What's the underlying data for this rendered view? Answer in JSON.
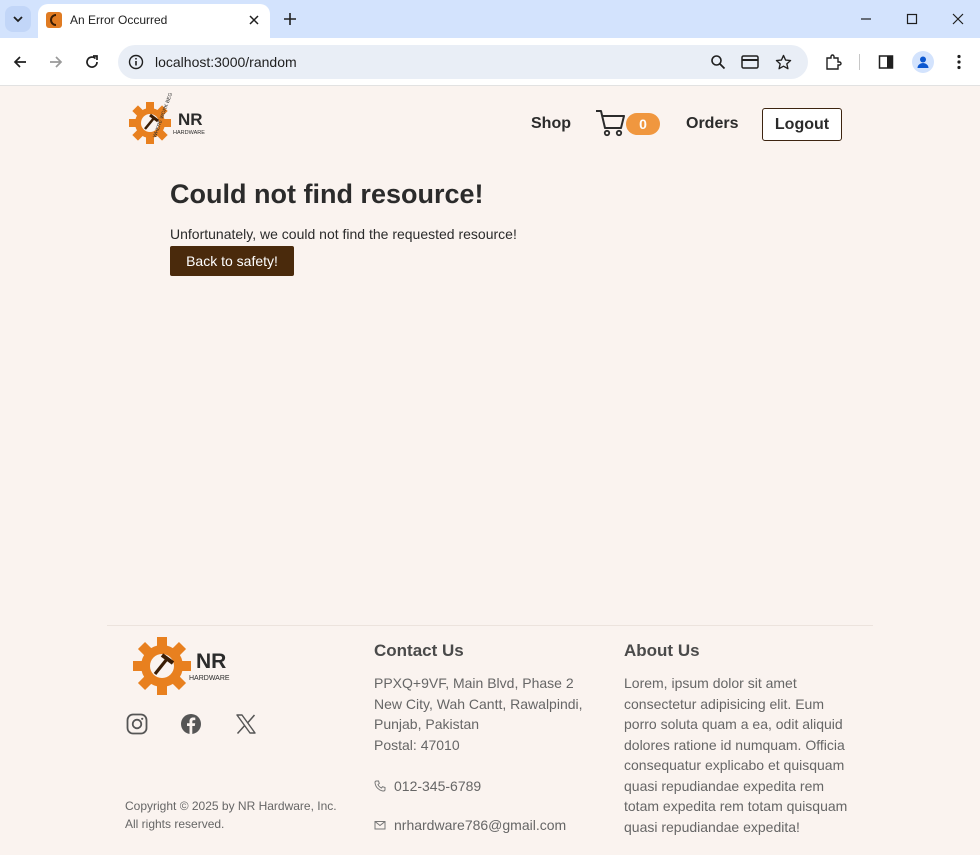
{
  "browser": {
    "tab_title": "An Error Occurred",
    "url": "localhost:3000/random"
  },
  "header": {
    "logo": {
      "brand": "NR",
      "sub": "HARDWARE",
      "tagline": "WHERE WORK BEGINS"
    },
    "nav_shop": "Shop",
    "cart_count": "0",
    "nav_orders": "Orders",
    "logout_label": "Logout"
  },
  "main": {
    "title": "Could not find resource!",
    "message": "Unfortunately, we could not find the requested resource!",
    "back_label": "Back to safety!"
  },
  "footer": {
    "copyright": "Copyright © 2025 by NR Hardware, Inc. All rights reserved.",
    "contact": {
      "title": "Contact Us",
      "address": [
        "PPXQ+9VF, Main Blvd, Phase 2 New City, Wah Cantt, Rawalpindi, Punjab, Pakistan",
        "Postal: 47010"
      ],
      "phone": "012-345-6789",
      "email": "nrhardware786@gmail.com"
    },
    "about": {
      "title": "About Us",
      "text": "Lorem, ipsum dolor sit amet consectetur adipisicing elit. Eum porro soluta quam a ea, odit aliquid dolores ratione id numquam. Officia consequatur explicabo et quisquam quasi repudiandae expedita rem totam expedita rem totam quisquam quasi repudiandae expedita!"
    }
  },
  "colors": {
    "accent": "#f0973f",
    "button_dark": "#4a2a0c",
    "page_bg": "#faf3ef",
    "brand_orange": "#e8801f"
  }
}
